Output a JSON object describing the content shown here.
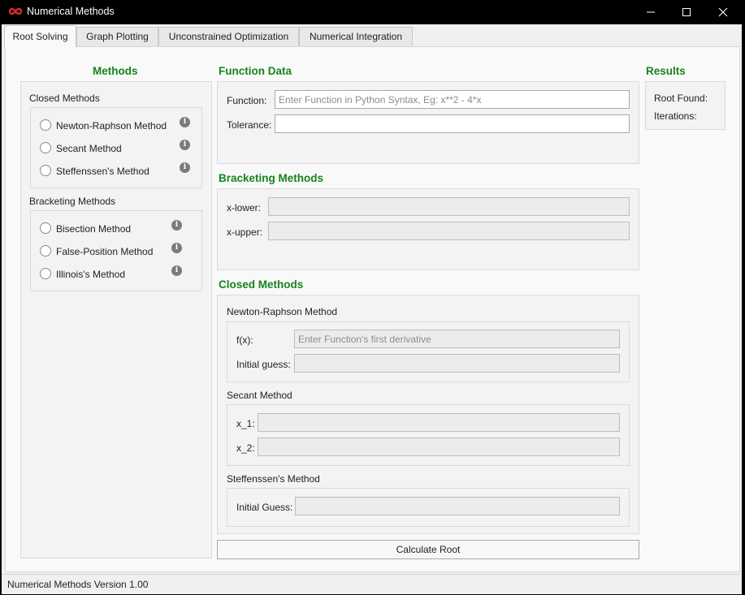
{
  "window": {
    "title": "Numerical Methods",
    "minimize": "—",
    "maximize": "☐",
    "close": "✕"
  },
  "tabs": [
    {
      "label": "Root Solving",
      "active": true
    },
    {
      "label": "Graph Plotting",
      "active": false
    },
    {
      "label": "Unconstrained Optimization",
      "active": false
    },
    {
      "label": "Numerical Integration",
      "active": false
    }
  ],
  "methods": {
    "heading": "Methods",
    "closed_group": {
      "title": "Closed Methods",
      "items": [
        "Newton-Raphson Method",
        "Secant Method",
        "Steffenssen's Method"
      ]
    },
    "bracketing_group": {
      "title": "Bracketing Methods",
      "items": [
        "Bisection Method",
        "False-Position Method",
        "Illinois's Method"
      ]
    },
    "info_glyph": "i"
  },
  "function_data": {
    "heading": "Function Data",
    "function_label": "Function:",
    "function_placeholder": "Enter Function in Python Syntax, Eg: x**2 - 4*x",
    "function_value": "",
    "tolerance_label": "Tolerance:",
    "tolerance_value": ""
  },
  "bracketing": {
    "heading": "Bracketing Methods",
    "x_lower_label": "x-lower:",
    "x_lower_value": "",
    "x_upper_label": "x-upper:",
    "x_upper_value": ""
  },
  "closed": {
    "heading": "Closed Methods",
    "newton": {
      "title": "Newton-Raphson Method",
      "fx_label": "f(x):",
      "fx_placeholder": "Enter Function's first derivative",
      "initial_guess_label": "Initial guess:"
    },
    "secant": {
      "title": "Secant Method",
      "x1_label": "x_1:",
      "x2_label": "x_2:"
    },
    "steffensen": {
      "title": "Steffenssen's Method",
      "initial_guess_label": "Initial Guess:"
    }
  },
  "results": {
    "heading": "Results",
    "root_found_label": "Root Found:",
    "iterations_label": "Iterations:"
  },
  "calculate_button": "Calculate Root",
  "status": "Numerical Methods Version 1.00",
  "colors": {
    "heading_green": "#16841b",
    "titlebar": "#000000",
    "app_icon_red": "#e0302a"
  }
}
